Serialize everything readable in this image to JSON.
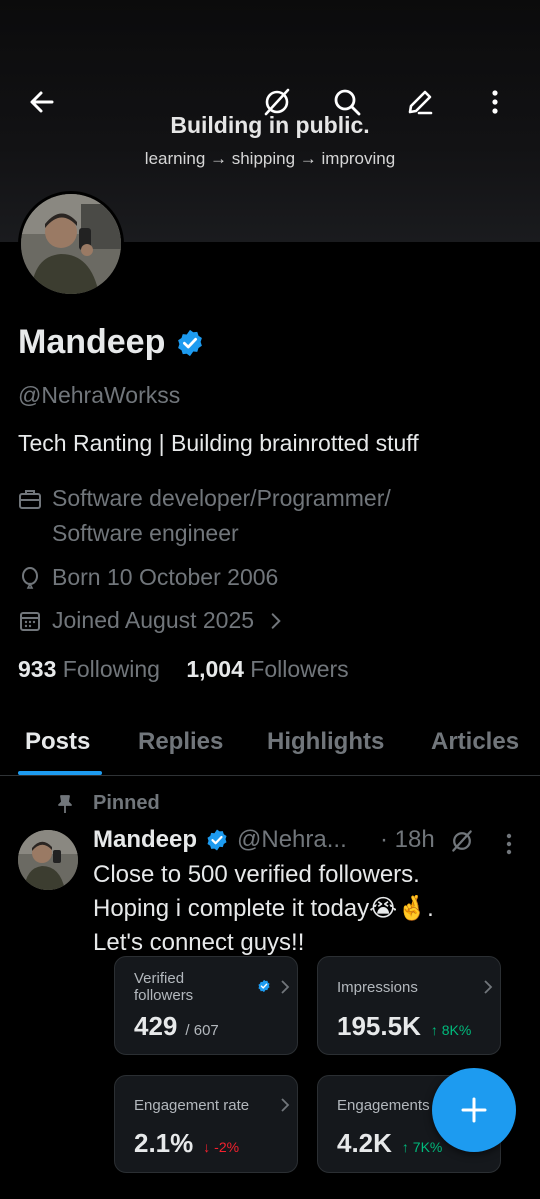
{
  "banner": {
    "title": "Building in public.",
    "subtitle": "learning → shipping → improving"
  },
  "top_icons": [
    "back-arrow-icon",
    "grok-icon",
    "search-icon",
    "edit-icon",
    "more-vertical-icon"
  ],
  "profile": {
    "name": "Mandeep",
    "handle": "@NehraWorkss",
    "bio": "Tech Ranting | Building brainrotted stuff",
    "profession_line1": "Software developer/Programmer/",
    "profession_line2": "Software engineer",
    "born": "Born 10 October 2006",
    "joined": "Joined August 2025",
    "following_count": "933",
    "following_label": "Following",
    "followers_count": "1,004",
    "followers_label": "Followers"
  },
  "tabs": [
    "Posts",
    "Replies",
    "Highlights",
    "Articles"
  ],
  "active_tab": "Posts",
  "post": {
    "pinned_label": "Pinned",
    "name": "Mandeep",
    "handle": "@Nehra...",
    "time": "· 18h",
    "line1": "Close to 500 verified followers.",
    "line2": "Hoping i complete it today😭🤞.",
    "line3": "Let's connect guys!!"
  },
  "stats": {
    "verified_followers": {
      "label_line1": "Verified",
      "label_line2": "followers",
      "value": "429",
      "total": "/ 607"
    },
    "impressions": {
      "label": "Impressions",
      "value": "195.5K",
      "change": "↑ 8K%"
    },
    "engagement_rate": {
      "label": "Engagement rate",
      "value": "2.1%",
      "change": "↓ -2%"
    },
    "engagements": {
      "label": "Engagements",
      "value": "4.2K",
      "change": "↑ 7K%"
    }
  },
  "colors": {
    "accent": "#1d9bf0",
    "background": "#000000",
    "muted_text": "#71767b",
    "positive": "#00ba7c",
    "negative": "#f4212e"
  }
}
